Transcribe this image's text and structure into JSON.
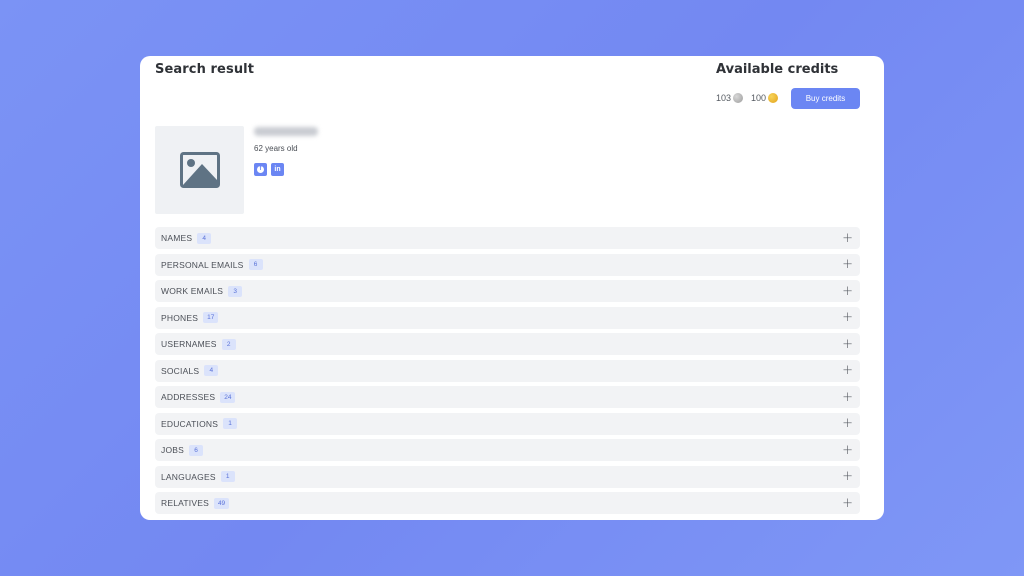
{
  "header": {
    "title": "Search result"
  },
  "credits": {
    "title": "Available credits",
    "silver_count": "103",
    "gold_count": "100",
    "buy_label": "Buy credits",
    "accent_color": "#6b86f3"
  },
  "profile": {
    "name_redacted": true,
    "age": "62 years old",
    "photo_icon": "image-placeholder-icon",
    "socials": [
      {
        "name": "facebook",
        "icon": "facebook-icon"
      },
      {
        "name": "linkedin",
        "icon": "linkedin-icon",
        "glyph": "in"
      }
    ]
  },
  "sections": [
    {
      "label": "NAMES",
      "count": "4"
    },
    {
      "label": "PERSONAL EMAILS",
      "count": "6"
    },
    {
      "label": "WORK EMAILS",
      "count": "3"
    },
    {
      "label": "PHONES",
      "count": "17"
    },
    {
      "label": "USERNAMES",
      "count": "2"
    },
    {
      "label": "SOCIALS",
      "count": "4"
    },
    {
      "label": "ADDRESSES",
      "count": "24"
    },
    {
      "label": "EDUCATIONS",
      "count": "1"
    },
    {
      "label": "JOBS",
      "count": "6"
    },
    {
      "label": "LANGUAGES",
      "count": "1"
    },
    {
      "label": "RELATIVES",
      "count": "49"
    }
  ],
  "expand_glyph": "+"
}
